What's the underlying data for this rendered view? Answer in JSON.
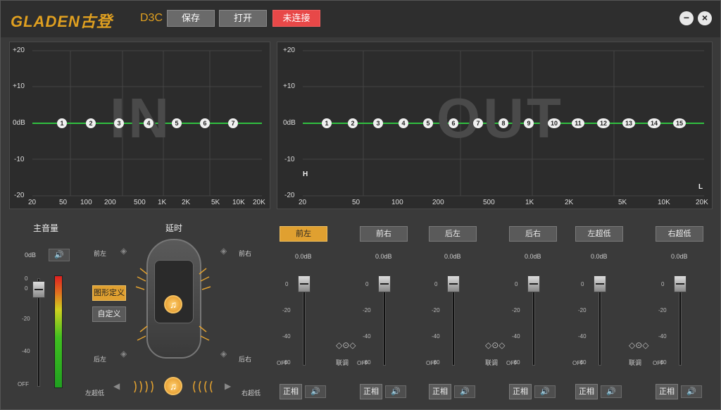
{
  "app": {
    "logo": "GLADEN古登",
    "model": "D3C"
  },
  "toolbar": {
    "save": "保存",
    "open": "打开",
    "connection": "未连接"
  },
  "window": {
    "minimize": "−",
    "close": "×"
  },
  "eq_in": {
    "bg": "IN",
    "y_labels": [
      "+20",
      "+10",
      "0dB",
      "-10",
      "-20"
    ],
    "x_labels": [
      "20",
      "50",
      "100",
      "200",
      "500",
      "1K",
      "2K",
      "5K",
      "10K",
      "20K"
    ],
    "nodes": [
      "1",
      "2",
      "3",
      "4",
      "5",
      "6",
      "7"
    ]
  },
  "eq_out": {
    "bg": "OUT",
    "y_labels": [
      "+20",
      "+10",
      "0dB",
      "-10",
      "-20"
    ],
    "x_labels": [
      "20",
      "50",
      "100",
      "200",
      "500",
      "1K",
      "2K",
      "5K",
      "10K",
      "20K"
    ],
    "nodes": [
      "1",
      "2",
      "3",
      "4",
      "5",
      "6",
      "7",
      "8",
      "9",
      "10",
      "11",
      "12",
      "13",
      "14",
      "15"
    ],
    "high_marker": "H",
    "low_marker": "L"
  },
  "master": {
    "title": "主音量",
    "value": "0dB",
    "scale": [
      "0",
      "0",
      "-20",
      "-40",
      "OFF"
    ]
  },
  "delay": {
    "title": "延时",
    "front_left": "前左",
    "front_right": "前右",
    "rear_left": "后左",
    "rear_right": "后右",
    "sub_left": "左超低",
    "sub_right": "右超低",
    "graphic_define": "图形定义",
    "custom": "自定义"
  },
  "channels": [
    {
      "name": "前左",
      "value": "0.0dB",
      "phase": "正相",
      "active": true
    },
    {
      "name": "前右",
      "value": "0.0dB",
      "phase": "正相",
      "active": false
    },
    {
      "name": "后左",
      "value": "0.0dB",
      "phase": "正相",
      "active": false
    },
    {
      "name": "后右",
      "value": "0.0dB",
      "phase": "正相",
      "active": false
    },
    {
      "name": "左超低",
      "value": "0.0dB",
      "phase": "正相",
      "active": false
    },
    {
      "name": "右超低",
      "value": "0.0dB",
      "phase": "正相",
      "active": false
    }
  ],
  "fader_scale": [
    "0",
    "-20",
    "-40",
    "-60",
    "OFF"
  ],
  "link_label": "联调",
  "colors": {
    "accent": "#e0a030",
    "eq_line": "#30c040",
    "disconnected": "#e84848"
  }
}
